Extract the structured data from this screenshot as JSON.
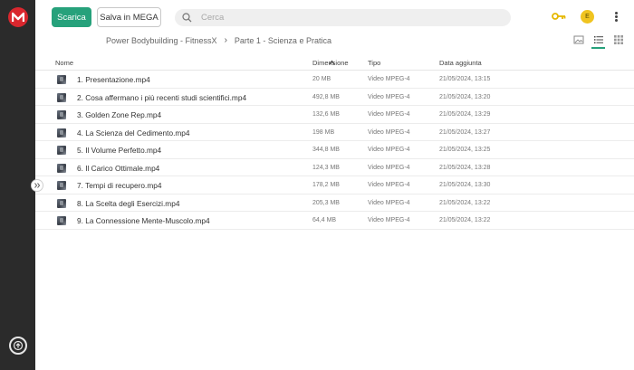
{
  "toolbar": {
    "download_label": "Scarica",
    "save_label": "Salva in MEGA"
  },
  "search": {
    "placeholder": "Cerca"
  },
  "account": {
    "avatar_initial": "E"
  },
  "breadcrumb": {
    "parent": "Power Bodybuilding - FitnessX",
    "separator": "›",
    "current": "Parte 1 - Scienza e Pratica"
  },
  "table": {
    "columns": {
      "name": "Nome",
      "size": "Dimensione",
      "type": "Tipo",
      "date": "Data aggiunta"
    },
    "rows": [
      {
        "name": "1. Presentazione.mp4",
        "size": "20 MB",
        "type": "Video MPEG-4",
        "date": "21/05/2024, 13:15"
      },
      {
        "name": "2. Cosa affermano i più recenti studi scientifici.mp4",
        "size": "492,8 MB",
        "type": "Video MPEG-4",
        "date": "21/05/2024, 13:20"
      },
      {
        "name": "3. Golden Zone Rep.mp4",
        "size": "132,6 MB",
        "type": "Video MPEG-4",
        "date": "21/05/2024, 13:29"
      },
      {
        "name": "4. La Scienza del Cedimento.mp4",
        "size": "198 MB",
        "type": "Video MPEG-4",
        "date": "21/05/2024, 13:27"
      },
      {
        "name": "5. Il Volume Perfetto.mp4",
        "size": "344,8 MB",
        "type": "Video MPEG-4",
        "date": "21/05/2024, 13:25"
      },
      {
        "name": "6. Il Carico Ottimale.mp4",
        "size": "124,3 MB",
        "type": "Video MPEG-4",
        "date": "21/05/2024, 13:28"
      },
      {
        "name": "7. Tempi di recupero.mp4",
        "size": "178,2 MB",
        "type": "Video MPEG-4",
        "date": "21/05/2024, 13:30"
      },
      {
        "name": "8. La Scelta degli Esercizi.mp4",
        "size": "205,3 MB",
        "type": "Video MPEG-4",
        "date": "21/05/2024, 13:22"
      },
      {
        "name": "9. La Connessione Mente-Muscolo.mp4",
        "size": "64,4 MB",
        "type": "Video MPEG-4",
        "date": "21/05/2024, 13:22"
      }
    ]
  },
  "colors": {
    "accent": "#26a17b",
    "brand": "#d9272e",
    "sidebar": "#2b2b2b",
    "key": "#e5b700",
    "avatar": "#f0c420"
  },
  "icons": {
    "logo": "mega-logo-icon",
    "search": "search-icon",
    "key": "key-icon",
    "menu": "kebab-menu-icon",
    "thumbnail_view": "thumbnail-view-icon",
    "list_view": "list-view-icon",
    "grid_view": "grid-view-icon",
    "sort": "sort-ascending-icon",
    "settings": "settings-gear-icon",
    "expand": "expand-sidebar-icon",
    "rail_bottom": "transfers-icon"
  }
}
